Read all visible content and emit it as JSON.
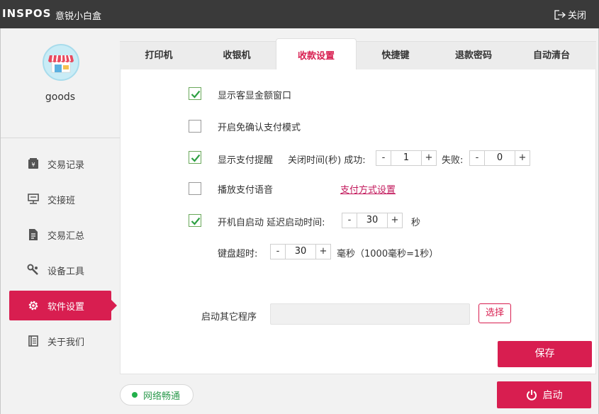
{
  "window": {
    "logo": "INSPOS",
    "app_name": "意锐小白盒",
    "close_label": "关闭"
  },
  "profile": {
    "username": "goods"
  },
  "sidebar": {
    "items": [
      {
        "label": "交易记录",
        "icon": "wallet-icon"
      },
      {
        "label": "交接班",
        "icon": "handover-icon"
      },
      {
        "label": "交易汇总",
        "icon": "summary-icon"
      },
      {
        "label": "设备工具",
        "icon": "tool-icon"
      },
      {
        "label": "软件设置",
        "icon": "gear-icon",
        "active": true
      },
      {
        "label": "关于我们",
        "icon": "book-icon"
      }
    ]
  },
  "tabs": [
    {
      "label": "打印机"
    },
    {
      "label": "收银机"
    },
    {
      "label": "收款设置",
      "active": true
    },
    {
      "label": "快捷键"
    },
    {
      "label": "退款密码"
    },
    {
      "label": "自动清台"
    }
  ],
  "settings": {
    "show_amount_window": {
      "label": "显示客显金额窗口",
      "checked": true
    },
    "no_confirm_pay": {
      "label": "开启免确认支付模式",
      "checked": false
    },
    "pay_reminder": {
      "label": "显示支付提醒",
      "checked": true,
      "close_time_label": "关闭时间(秒) 成功:",
      "success_value": "1",
      "fail_label": "失败:",
      "fail_value": "0"
    },
    "pay_voice": {
      "label": "播放支付语音",
      "checked": false,
      "link": "支付方式设置"
    },
    "auto_start": {
      "label": "开机自启动 延迟启动时间:",
      "checked": true,
      "value": "30",
      "unit": "秒"
    },
    "keyboard_timeout": {
      "label": "键盘超时:",
      "value": "30",
      "unit": "毫秒（1000毫秒=1秒）"
    },
    "launch_program": {
      "label": "启动其它程序",
      "value": "",
      "choose_label": "选择"
    },
    "save_label": "保存"
  },
  "footer": {
    "network_status": "网络畅通",
    "start_label": "启动"
  },
  "colors": {
    "accent": "#d81e50",
    "titlebar": "#3a3a3a",
    "check": "#2ea043",
    "online": "#22b04b"
  },
  "stepper_symbols": {
    "minus": "-",
    "plus": "+"
  }
}
